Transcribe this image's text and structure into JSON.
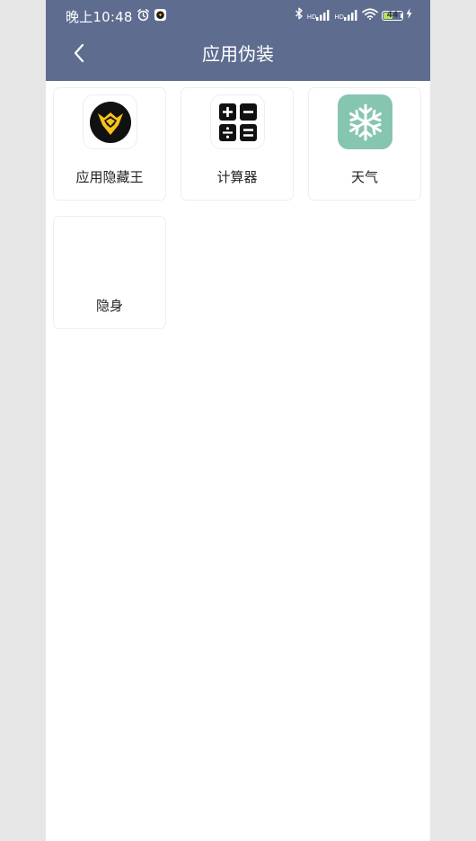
{
  "status": {
    "time": "晚上10:48",
    "hd1": "HD",
    "hd2": "HD",
    "battery": "44",
    "icons": [
      "alarm-icon",
      "app-notification-icon",
      "bluetooth-icon",
      "signal-icon",
      "wifi-icon",
      "battery-icon",
      "charging-icon"
    ]
  },
  "header": {
    "title": "应用伪装",
    "background": "#5e6c8f"
  },
  "apps": [
    {
      "label": "应用隐藏王",
      "icon": "crown-logo-icon"
    },
    {
      "label": "计算器",
      "icon": "calculator-icon"
    },
    {
      "label": "天气",
      "icon": "snowflake-icon",
      "icon_bg": "#86c5b0"
    },
    {
      "label": "隐身",
      "icon": ""
    }
  ]
}
